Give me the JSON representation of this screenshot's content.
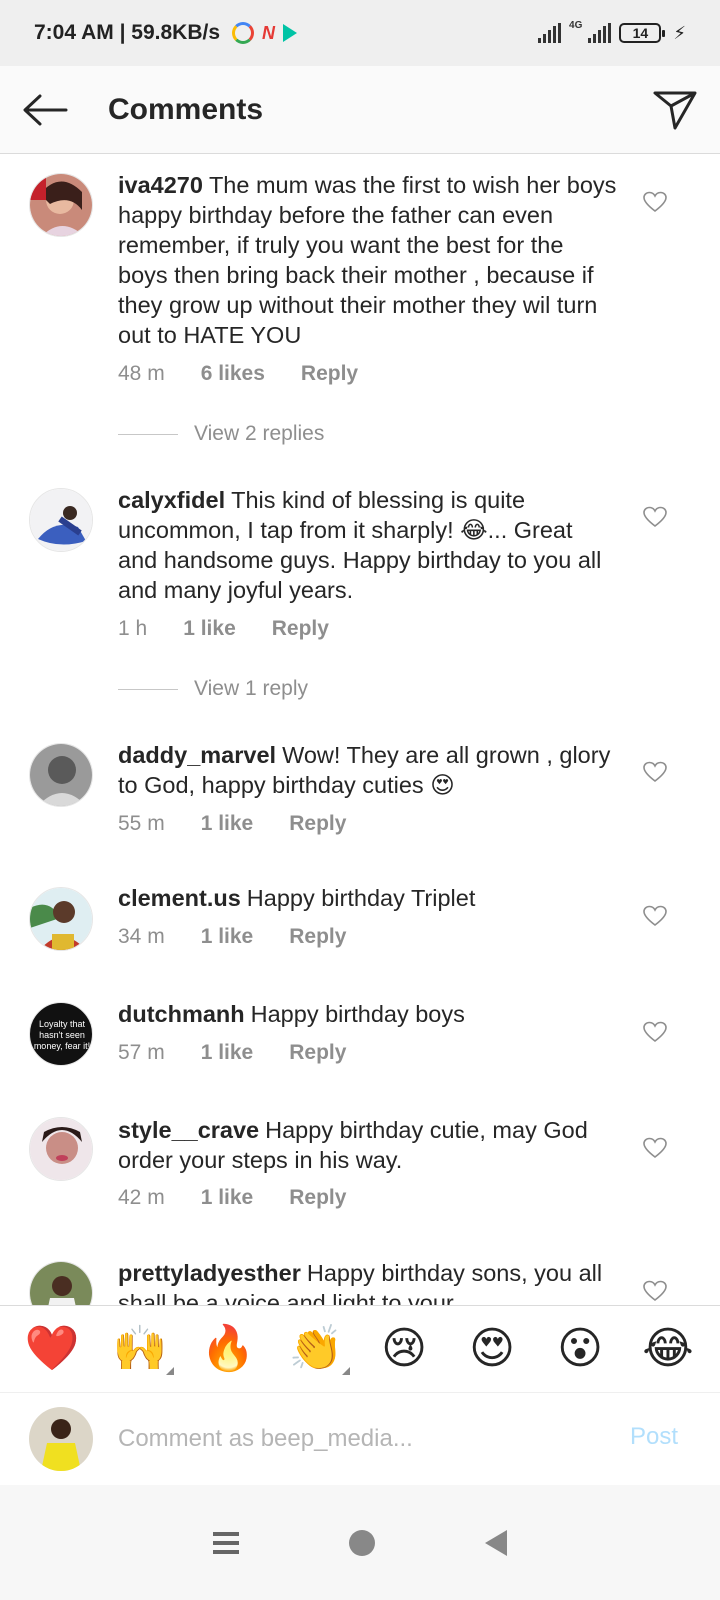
{
  "status_bar": {
    "time_speed": "7:04 AM | 59.8KB/s",
    "network": "4G",
    "battery": "14"
  },
  "header": {
    "title": "Comments"
  },
  "comments": [
    {
      "username": "iva4270",
      "text": "The mum was the first to wish her boys happy birthday before the father can even remember, if truly you want the best for the boys then bring back their mother , because if they grow up without their mother they wil turn out to HATE YOU",
      "time": "48 m",
      "likes": "6 likes",
      "reply": "Reply",
      "view_replies": "View 2 replies"
    },
    {
      "username": "calyxfidel",
      "text": "This kind of blessing is quite uncommon, I tap from it sharply! 😂... Great and handsome guys. Happy birthday to you all and many joyful years.",
      "time": "1 h",
      "likes": "1 like",
      "reply": "Reply",
      "view_replies": "View 1 reply"
    },
    {
      "username": "daddy_marvel",
      "text": "Wow! They are all grown , glory to God, happy birthday cuties 😍",
      "time": "55 m",
      "likes": "1 like",
      "reply": "Reply"
    },
    {
      "username": "clement.us",
      "text": "Happy birthday Triplet",
      "time": "34 m",
      "likes": "1 like",
      "reply": "Reply"
    },
    {
      "username": "dutchmanh",
      "text": "Happy birthday boys",
      "time": "57 m",
      "likes": "1 like",
      "reply": "Reply",
      "avatar_text": "Loyalty that hasn't seen money, fear it!"
    },
    {
      "username": "style__crave",
      "text": "Happy birthday cutie, may God order your steps in his way.",
      "time": "42 m",
      "likes": "1 like",
      "reply": "Reply"
    },
    {
      "username": "prettyladyesther",
      "text": "Happy birthday sons, you all shall be a voice and light to your"
    }
  ],
  "emoji_bar": [
    "❤️",
    "🙌",
    "🔥",
    "👏",
    "😢",
    "😍",
    "😮",
    "😂"
  ],
  "input": {
    "placeholder": "Comment as beep_media...",
    "post_label": "Post"
  },
  "colors": {
    "post_disabled": "#b2dffc",
    "meta_gray": "#8e8e8e",
    "text": "#262626"
  }
}
